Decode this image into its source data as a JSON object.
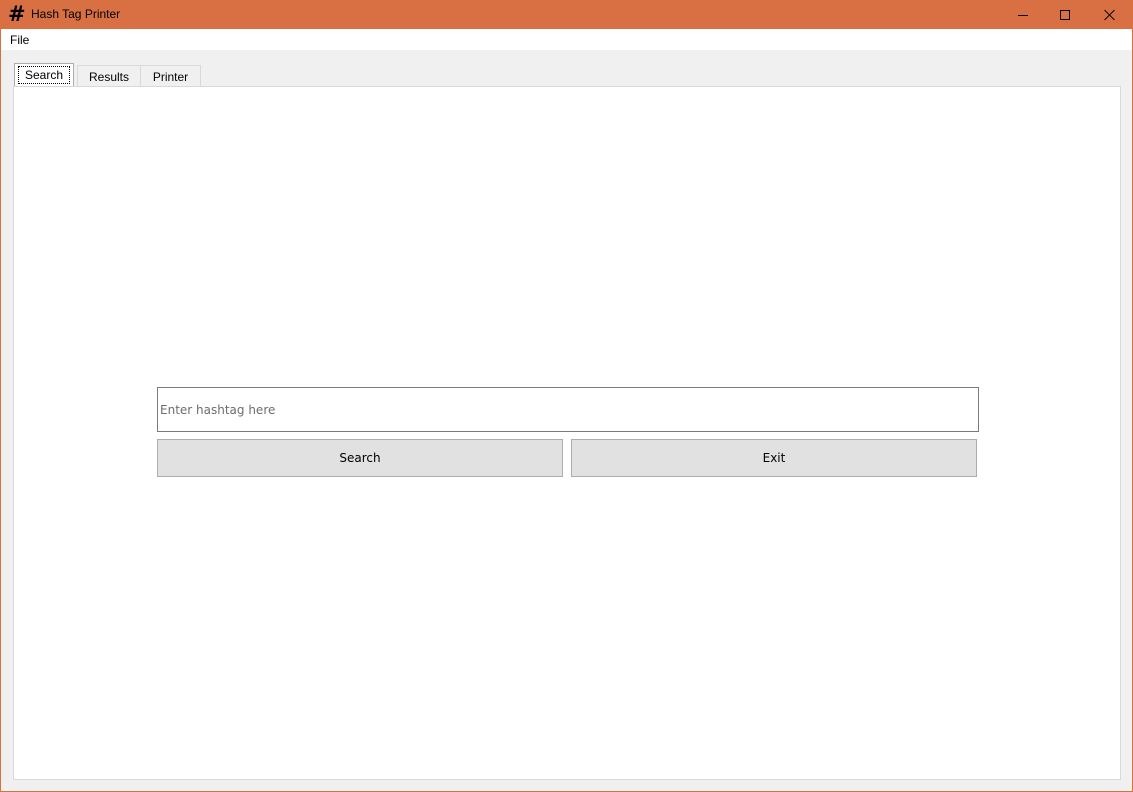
{
  "window": {
    "title": "Hash Tag Printer",
    "icon": "hash-icon",
    "controls": [
      "minimize-icon",
      "maximize-icon",
      "close-icon"
    ]
  },
  "menu": {
    "items": [
      {
        "label": "File"
      }
    ]
  },
  "tabs": [
    {
      "label": "Search",
      "active": true
    },
    {
      "label": "Results",
      "active": false
    },
    {
      "label": "Printer",
      "active": false
    }
  ],
  "search_tab": {
    "input": {
      "value": "",
      "placeholder": "Enter hashtag here"
    },
    "search_button": "Search",
    "exit_button": "Exit"
  },
  "colors": {
    "titlebar": "#d87044",
    "button_bg": "#e1e1e1"
  }
}
